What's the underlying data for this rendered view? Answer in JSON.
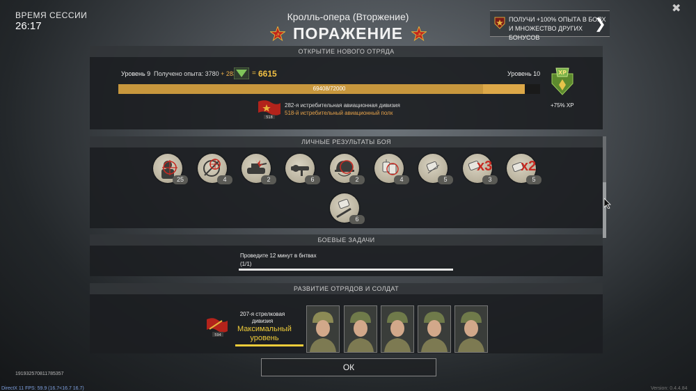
{
  "session": {
    "label": "ВРЕМЯ СЕССИИ",
    "time": "26:17"
  },
  "header": {
    "mode_title": "Кролль-опера (Вторжение)",
    "result_title": "ПОРАЖЕНИЕ"
  },
  "promo": {
    "line1": "ПОЛУЧИ +100% ОПЫТА В БОЯХ",
    "line2": "И МНОЖЕСТВО ДРУГИХ БОНУСОВ"
  },
  "close_glyph": "✖",
  "new_squad": {
    "section_title": "ОТКРЫТИЕ НОВОГО ОТРЯДА",
    "level_current": "Уровень 9",
    "xp_label": "Получено опыта: 3780",
    "xp_plus": "+",
    "xp_bonus": "2835",
    "xp_equals": "=",
    "xp_total": "6615",
    "level_next": "Уровень 10",
    "progress_text": "69408/72000",
    "progress_base_fraction": 0.865,
    "progress_total_fraction": 0.964,
    "division": "282-я истребительная авиационная дивизия",
    "regiment": "518-й истребительный авиационный полк",
    "flag_number": "518",
    "xp_badge": "XP",
    "xp_boost": "+75% XP"
  },
  "personal": {
    "section_title": "ЛИЧНЫЕ РЕЗУЛЬТАТЫ БОЯ",
    "awards": [
      {
        "icon": "infantry-kill-icon",
        "count": "25"
      },
      {
        "icon": "crosshair-icon",
        "count": "4"
      },
      {
        "icon": "tank-kill-icon",
        "count": "2"
      },
      {
        "icon": "scope-icon",
        "count": "6"
      },
      {
        "icon": "helmet-headshot-icon",
        "count": "2"
      },
      {
        "icon": "dogtags-icon",
        "count": "4"
      },
      {
        "icon": "dogtag-icon",
        "count": "5"
      },
      {
        "icon": "dogtag-x3-icon",
        "count": "3",
        "mark": "x3"
      },
      {
        "icon": "dogtag-x2-icon",
        "count": "5",
        "mark": "x2"
      },
      {
        "icon": "dogtag-bayonet-icon",
        "count": "6"
      }
    ]
  },
  "tasks": {
    "section_title": "БОЕВЫЕ ЗАДАЧИ",
    "task_text": "Проведите 12 минут в бнтвах",
    "task_progress": "(1/1)",
    "task_fraction": 1.0
  },
  "development": {
    "section_title": "РАЗВИТИЕ ОТРЯДОВ И СОЛДАТ",
    "unit_name_1": "207-я стрелковая",
    "unit_name_2": "дивизия",
    "max_1": "Максимальный",
    "max_2": "уровень",
    "flag_number": "594"
  },
  "ok_label": "ОК",
  "session_id": "1919325708117853​57",
  "fps_text": "DirectX 11 FPS: 59.9 (16.7<16.7 16.7)",
  "version_text": "Version: 0.4.4.84",
  "colors": {
    "accent": "#c8973d",
    "gold": "#f3c143",
    "star_red": "#c0241b"
  }
}
